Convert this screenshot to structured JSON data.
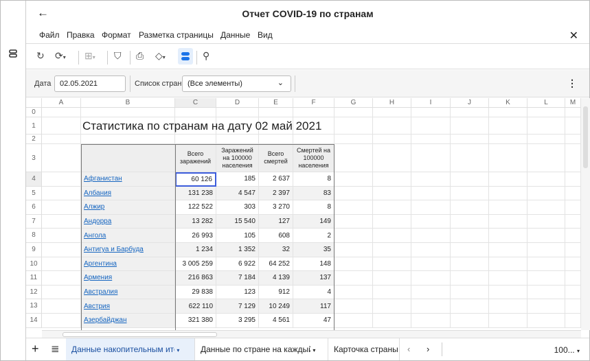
{
  "title": "Отчет COVID-19 по странам",
  "menu": [
    "Файл",
    "Правка",
    "Формат",
    "Разметка страницы",
    "Данные",
    "Вид"
  ],
  "filters": {
    "date_label": "Дата",
    "date_value": "02.05.2021",
    "countries_label": "Список стран",
    "countries_value": "(Все элементы)"
  },
  "columns": [
    "A",
    "B",
    "C",
    "D",
    "E",
    "F",
    "G",
    "H",
    "I",
    "J",
    "K",
    "L",
    "M"
  ],
  "sheet_title": "Статистика по странам на дату 02 май 2021",
  "table_headers": [
    "Всего заражений",
    "Заражений на 100000 населения",
    "Всего смертей",
    "Смертей на 100000 населения"
  ],
  "rows": [
    [
      "Афганистан",
      "60 126",
      "185",
      "2 637",
      "8"
    ],
    [
      "Албания",
      "131 238",
      "4 547",
      "2 397",
      "83"
    ],
    [
      "Алжир",
      "122 522",
      "303",
      "3 270",
      "8"
    ],
    [
      "Андорра",
      "13 282",
      "15 540",
      "127",
      "149"
    ],
    [
      "Ангола",
      "26 993",
      "105",
      "608",
      "2"
    ],
    [
      "Антигуа и Барбуда",
      "1 234",
      "1 352",
      "32",
      "35"
    ],
    [
      "Аргентина",
      "3 005 259",
      "6 922",
      "64 252",
      "148"
    ],
    [
      "Армения",
      "216 863",
      "7 184",
      "4 139",
      "137"
    ],
    [
      "Австралия",
      "29 838",
      "123",
      "912",
      "4"
    ],
    [
      "Австрия",
      "622 110",
      "7 129",
      "10 249",
      "117"
    ],
    [
      "Азербайджан",
      "321 380",
      "3 295",
      "4 561",
      "47"
    ]
  ],
  "tabs": [
    "Данные накопительным итогом",
    "Данные по стране на каждый",
    "Карточка страны"
  ],
  "zoom": "100..."
}
